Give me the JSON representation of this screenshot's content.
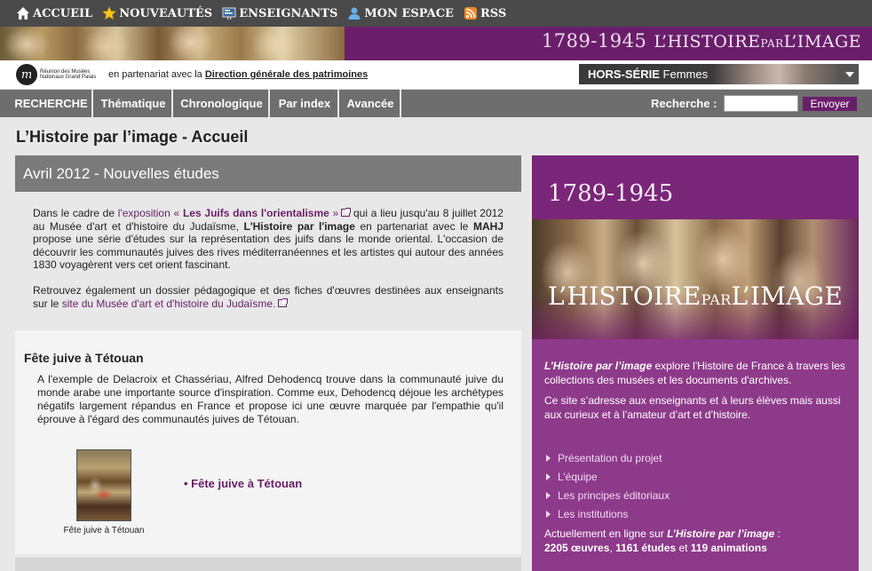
{
  "topnav": {
    "items": [
      {
        "label": "ACCUEIL",
        "icon": "home-icon"
      },
      {
        "label": "NOUVEAUTÉS",
        "icon": "star-icon"
      },
      {
        "label": "ENSEIGNANTS",
        "icon": "blackboard-icon"
      },
      {
        "label": "MON ESPACE",
        "icon": "user-icon"
      },
      {
        "label": "RSS",
        "icon": "rss-icon"
      }
    ]
  },
  "banner": {
    "years": "1789-1945",
    "title_part1": "L’HISTOIRE",
    "title_small": "PAR",
    "title_part2": "L’IMAGE"
  },
  "partner": {
    "logo_letter": "m",
    "logo_text": "Réunion des Musées Nationaux Grand Palais",
    "text": "en partenariat avec la",
    "link": "Direction générale des patrimoines",
    "hors_serie_bold": "HORS-SÉRIE",
    "hors_serie_rest": " Femmes"
  },
  "searchbar": {
    "tabs": [
      "RECHERCHE",
      "Thématique",
      "Chronologique",
      "Par index",
      "Avancée"
    ],
    "label": "Recherche :",
    "input_value": "",
    "button": "Envoyer"
  },
  "main": {
    "page_title": "L’Histoire par l’image - Accueil",
    "news_header": "Avril 2012 - Nouvelles études",
    "intro": {
      "p1_a": "Dans le cadre de ",
      "p1_link1": "l'exposition « ",
      "p1_link1_bold": "Les Juifs dans l'orientalisme",
      "p1_link1_end": " »",
      "p1_b": " qui a lieu jusqu'au 8 juillet 2012 au Musée d'art et d'histoire du Judaïsme, ",
      "p1_bold1": "L'Histoire par l'image",
      "p1_c": " en partenariat avec le ",
      "p1_bold2": "MAHJ",
      "p1_d": " propose une série d'études sur la représentation des juifs dans le monde oriental. L'occasion de découvrir les communautés juives des rives méditerranéennes et les artistes qui autour des années 1830 voyagèrent vers cet orient fascinant.",
      "p2_a": "Retrouvez également un dossier pédagogique et des fiches d'œuvres destinées aux enseignants sur le ",
      "p2_link": "site du Musée d'art et d'histoire du Judaïsme."
    },
    "article": {
      "title": "Fête juive à Tétouan",
      "text": "A l'exemple de Delacroix et Chassériau, Alfred Dehodencq trouve dans la communauté juive du monde arabe une importante source d'inspiration. Comme eux, Dehodencq déjoue les archétypes négatifs largement répandus en France et propose ici une œuvre marquée par l'empathie qu'il éprouve à l'égard des communautés juives de Tétouan.",
      "thumb_caption": "Fête juive à Tétouan",
      "link": "• Fête juive à Tétouan"
    }
  },
  "promo": {
    "years": "1789-1945",
    "brand_part1": "L’HISTOIRE",
    "brand_small": "PAR",
    "brand_part2": "L’IMAGE",
    "p1_italic": "L’Histoire par l’image",
    "p1_rest": " explore l'Histoire de France à travers les collections des musées et les documents d'archives.",
    "p2": "Ce site s’adresse aux enseignants et à leurs élèves mais aussi aux curieux et à l’amateur d’art et d’histoire.",
    "links": [
      "Présentation du projet",
      "L’équipe",
      "Les principes éditoriaux",
      "Les institutions"
    ],
    "online_prefix": "Actuellement en ligne sur ",
    "online_italic": "L’Histoire par l’image",
    "online_colon": " :",
    "count_oeuvres": "2205 œuvres",
    "sep1": ", ",
    "count_etudes": "1161 études",
    "sep2": " et ",
    "count_animations": "119 animations"
  }
}
